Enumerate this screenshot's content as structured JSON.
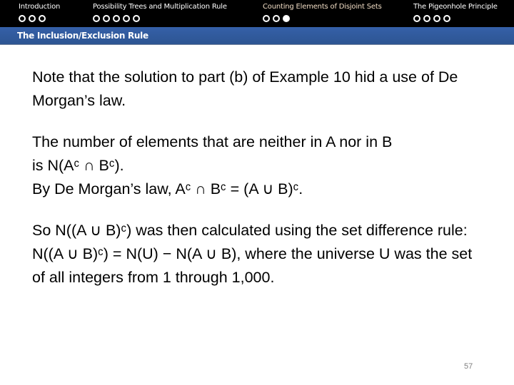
{
  "nav": {
    "sections": [
      {
        "title": "Introduction",
        "dots": 3,
        "filled": [],
        "active": false
      },
      {
        "title": "Possibility Trees and Multiplication Rule",
        "dots": 5,
        "filled": [],
        "active": false
      },
      {
        "title": "Counting Elements of Disjoint Sets",
        "dots": 3,
        "filled": [
          2
        ],
        "active": true
      },
      {
        "title": "The Pigeonhole Principle",
        "dots": 4,
        "filled": [],
        "active": false
      }
    ],
    "subsection": "The Inclusion/Exclusion Rule"
  },
  "body": {
    "p1": "Note that the solution to part (b) of Example 10 hid a use of De Morgan’s law.",
    "p2_line1": "The number of elements that are neither in A nor in B",
    "p2_line2": "is N(Aᶜ ∩ Bᶜ).",
    "p2_line3": "By De Morgan’s law, Aᶜ ∩ Bᶜ = (A ∪ B)ᶜ.",
    "p3": "So N((A ∪ B)ᶜ) was then calculated using the set difference rule: N((A ∪ B)ᶜ) = N(U) − N(A ∪ B), where the universe U was the set of all integers from 1 through 1,000."
  },
  "page_number": "57"
}
